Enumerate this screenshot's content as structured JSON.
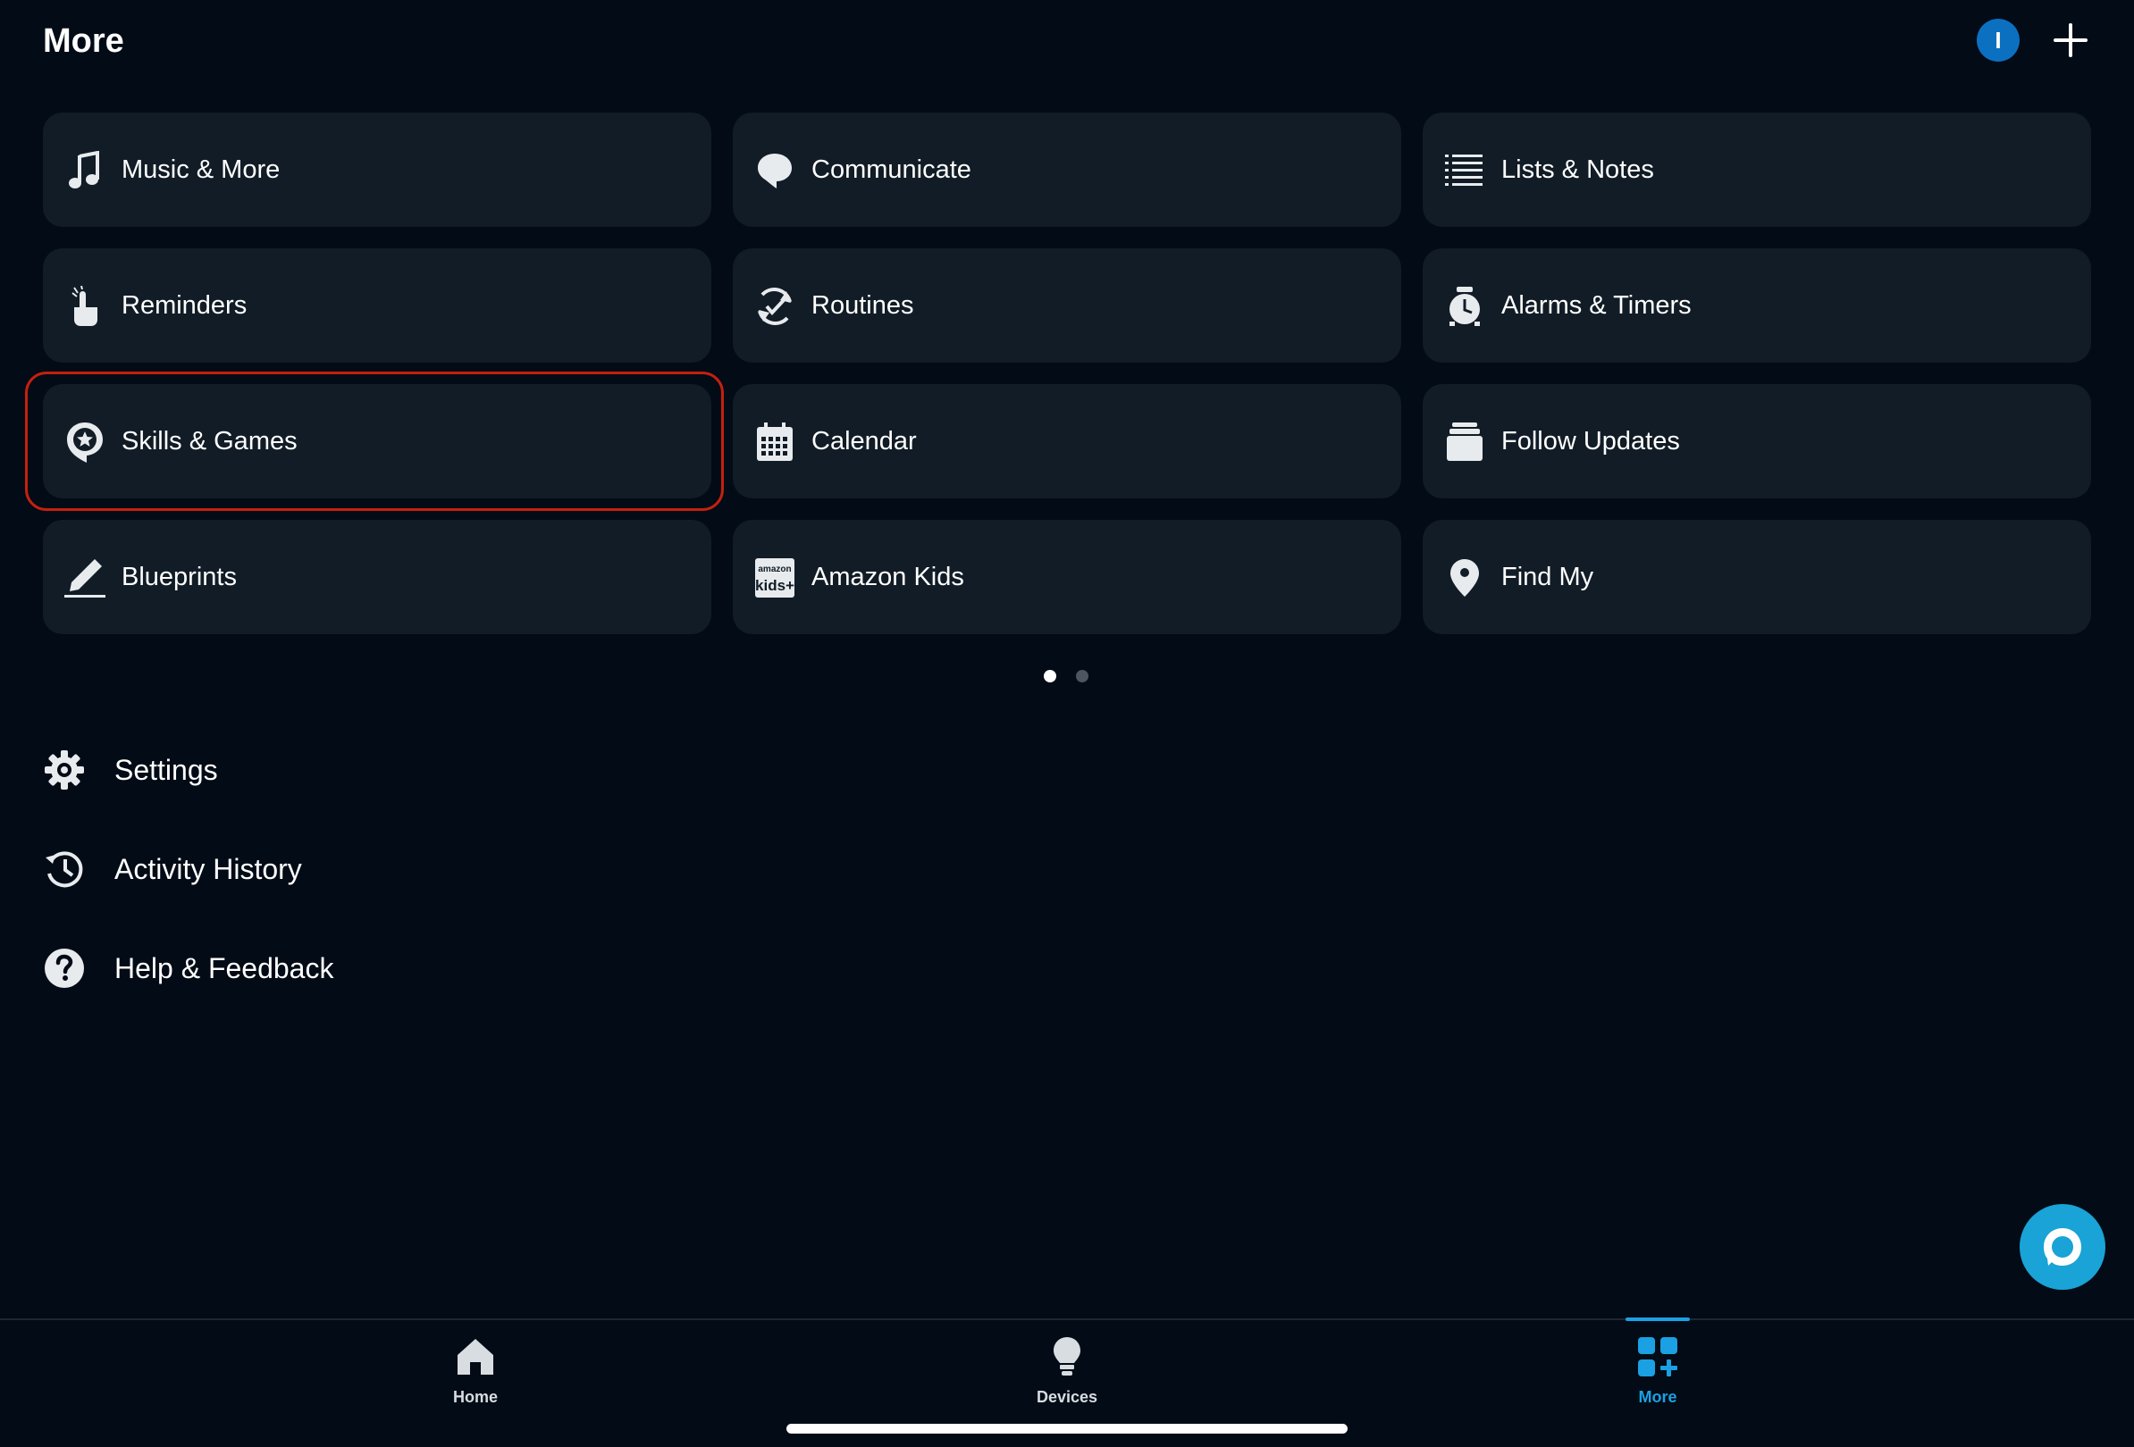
{
  "header": {
    "title": "More",
    "avatar_initial": "I"
  },
  "tiles": [
    {
      "label": "Music & More",
      "icon": "music-note-icon"
    },
    {
      "label": "Communicate",
      "icon": "speech-bubble-icon"
    },
    {
      "label": "Lists & Notes",
      "icon": "list-icon"
    },
    {
      "label": "Reminders",
      "icon": "reminder-hand-icon"
    },
    {
      "label": "Routines",
      "icon": "routine-check-icon"
    },
    {
      "label": "Alarms & Timers",
      "icon": "alarm-clock-icon"
    },
    {
      "label": "Skills & Games",
      "icon": "skill-star-bubble-icon",
      "highlighted": true
    },
    {
      "label": "Calendar",
      "icon": "calendar-icon"
    },
    {
      "label": "Follow Updates",
      "icon": "stacked-cards-icon"
    },
    {
      "label": "Blueprints",
      "icon": "pencil-icon"
    },
    {
      "label": "Amazon Kids",
      "icon": "amazon-kids-logo-icon",
      "logo_text_top": "amazon",
      "logo_text_bottom": "kids+"
    },
    {
      "label": "Find My",
      "icon": "location-pin-icon"
    }
  ],
  "pager": {
    "pages": 2,
    "current": 1
  },
  "menu": [
    {
      "label": "Settings",
      "icon": "gear-icon"
    },
    {
      "label": "Activity History",
      "icon": "history-clock-icon"
    },
    {
      "label": "Help & Feedback",
      "icon": "help-question-icon"
    }
  ],
  "bottom_nav": [
    {
      "label": "Home",
      "icon": "home-icon",
      "active": false
    },
    {
      "label": "Devices",
      "icon": "lightbulb-icon",
      "active": false
    },
    {
      "label": "More",
      "icon": "more-grid-icon",
      "active": true
    }
  ],
  "colors": {
    "background": "#020b16",
    "tile": "#111c26",
    "accent": "#1aa0e3",
    "highlight": "#c4200e",
    "avatar": "#0b70c0",
    "fab": "#19a3d6"
  }
}
